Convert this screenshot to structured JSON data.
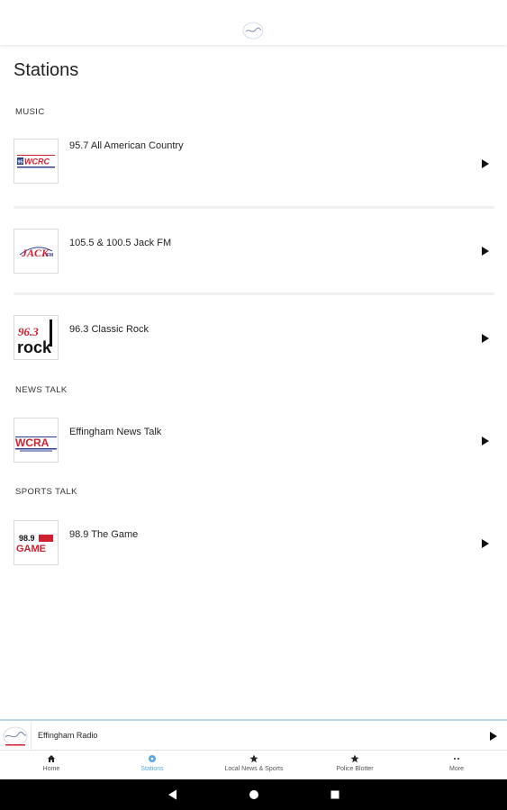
{
  "page": {
    "title": "Stations"
  },
  "sections": [
    {
      "header": "MUSIC",
      "stations": [
        {
          "title": "95.7 All American Country",
          "logo": "wcrc-logo"
        },
        {
          "title": "105.5 & 100.5 Jack FM",
          "logo": "jack-fm-logo"
        },
        {
          "title": "96.3 Classic Rock",
          "logo": "rock-logo"
        }
      ]
    },
    {
      "header": "NEWS TALK",
      "stations": [
        {
          "title": "Effingham News Talk",
          "logo": "wcra-logo"
        }
      ]
    },
    {
      "header": "SPORTS TALK",
      "stations": [
        {
          "title": "98.9 The Game",
          "logo": "the-game-logo"
        }
      ]
    }
  ],
  "mini_player": {
    "title": "Effingham Radio"
  },
  "tabs": [
    {
      "label": "Home",
      "icon": "home-icon"
    },
    {
      "label": "Stations",
      "icon": "stations-icon",
      "active": true
    },
    {
      "label": "Local News & Sports",
      "icon": "star-icon"
    },
    {
      "label": "Police Blotter",
      "icon": "star-icon"
    },
    {
      "label": "More",
      "icon": "more-icon"
    }
  ],
  "logos": {
    "wcrc": {
      "freq": "95.",
      "name": "WCRC"
    },
    "jack": {
      "name": "JACK",
      "small": "FM"
    },
    "rock": {
      "freq": "96.3",
      "name": "rock"
    },
    "wcra": {
      "name": "WCRA"
    },
    "game": {
      "freq": "98.9",
      "name": "GAME"
    }
  },
  "colors": {
    "accent": "#5aa9dd",
    "logo_red": "#d0202e",
    "logo_blue": "#2b3f8f",
    "navbar": "#000000"
  }
}
